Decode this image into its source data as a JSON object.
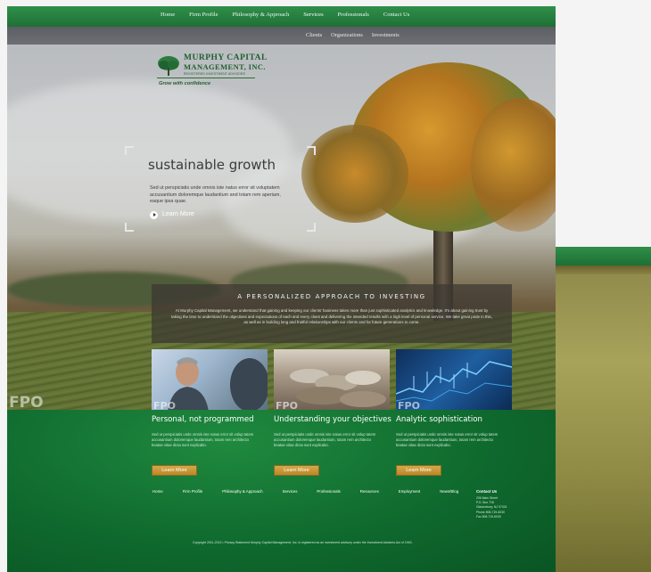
{
  "nav": {
    "top": [
      "Home",
      "Firm Profile",
      "Philosophy & Approach",
      "Services",
      "Professionals",
      "Contact Us"
    ],
    "sub": [
      "Clients",
      "Organizations",
      "Investments"
    ]
  },
  "logo": {
    "line1": "MURPHY CAPITAL",
    "line2": "MANAGEMENT, INC.",
    "line3": "REGISTERED INVESTMENT ADVISORS",
    "tagline": "Grow with confidence"
  },
  "hero": {
    "headline": "sustainable growth",
    "body": "Sed ut perspiciatis unde omnis iste natus error sit voluptatem accusantium doloremque laudantium and totam rem aperiam, eaque ipsa quae.",
    "cta": "Learn More",
    "fpo": "FPO"
  },
  "approach": {
    "title": "A PERSONALIZED APPROACH TO INVESTING",
    "body": "At Murphy Capital Management, we understand that gaining and keeping our clients' business takes more than just sophisticated analytics and knowledge. It's about gaining trust by taking the time to understand the objectives and expectations of each and every client and delivering the intended results with a high level of personal service. We take great pride in this, as well as in building long and fruitful relationships with our clients and for future generations to come."
  },
  "photos": [
    "FPO",
    "FPO",
    "FPO"
  ],
  "columns": [
    {
      "title": "Personal, not programmed",
      "body": "Sed ut perspiciatis unde omnis iste natus error sit volup tatem accusantium doloremque laudantium, totam rem architecto beatae vitae dicta sunt explicabo.",
      "button": "Learn More"
    },
    {
      "title": "Understanding your objectives",
      "body": "Sed ut perspiciatis unde omnis iste natus error sit volup tatem accusantium doloremque laudantium, totam rem architecto beatae vitae dicta sunt explicabo.",
      "button": "Learn More"
    },
    {
      "title": "Analytic sophistication",
      "body": "Sed ut perspiciatis unde omnis iste natus error sit volup tatem accusantium doloremque laudantium, totam rem architecto beatae vitae dicta sunt explicabo.",
      "button": "Learn More"
    }
  ],
  "footer": {
    "nav": [
      "Home",
      "Firm Profile",
      "Philosophy & Approach",
      "Services",
      "Professionals",
      "Resources",
      "Employment",
      "News/Blog"
    ],
    "contact_title": "Contact Us",
    "contact_lines": [
      "206 Main Street",
      "P.O. Box 718",
      "Glastonbury, NJ 07024",
      "Phone 808-719-6030",
      "Fax 808-719-6030"
    ],
    "copyright": "Copyright 2011-2013 • Privacy Statement     Murphy Capital Management, Inc. is registered as an investment advisory under the Investment Advisers Act of 1940."
  }
}
